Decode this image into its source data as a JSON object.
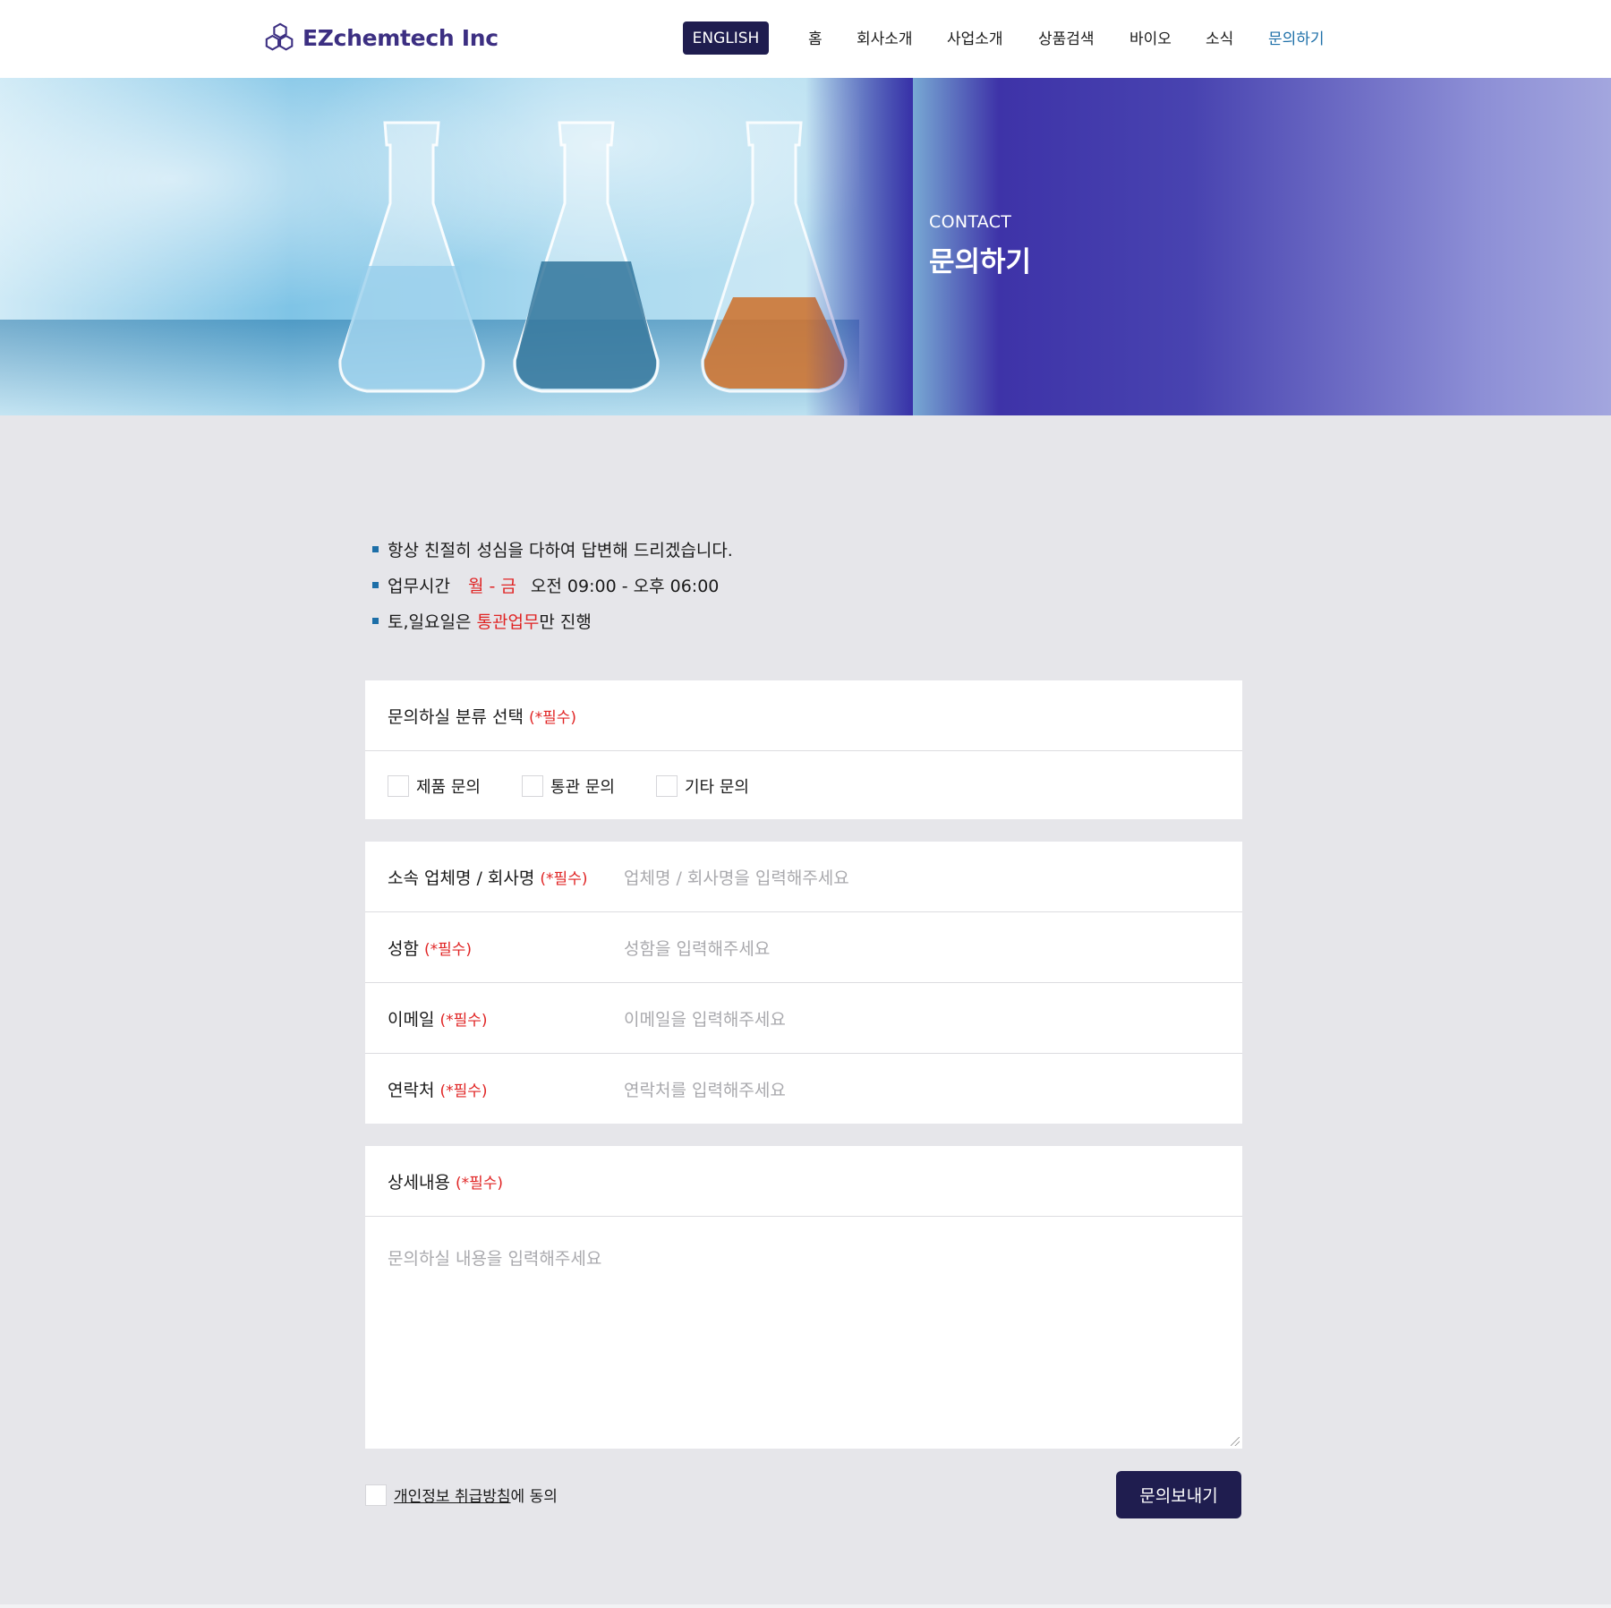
{
  "header": {
    "logo_text": "EZchemtech Inc",
    "lang_button": "ENGLISH",
    "nav": [
      {
        "label": "홈"
      },
      {
        "label": "회사소개"
      },
      {
        "label": "사업소개"
      },
      {
        "label": "상품검색"
      },
      {
        "label": "바이오"
      },
      {
        "label": "소식"
      },
      {
        "label": "문의하기",
        "active": true
      }
    ]
  },
  "hero": {
    "subtitle": "CONTACT",
    "title": "문의하기"
  },
  "info": {
    "line1": "항상 친절히 성심을 다하여 답변해 드리겠습니다.",
    "line2_prefix": "업무시간",
    "line2_days": "월 - 금",
    "line2_hours": "오전 09:00 - 오후 06:00",
    "line3_prefix": "토,일요일은 ",
    "line3_highlight": "통관업무",
    "line3_suffix": "만 진행"
  },
  "form": {
    "required_mark": "(*필수)",
    "category": {
      "label": "문의하실 분류 선택",
      "options": [
        "제품 문의",
        "통관 문의",
        "기타 문의"
      ]
    },
    "company": {
      "label": "소속 업체명 / 회사명",
      "placeholder": "업체명 / 회사명을 입력해주세요"
    },
    "name": {
      "label": "성함",
      "placeholder": "성함을 입력해주세요"
    },
    "email": {
      "label": "이메일",
      "placeholder": "이메일을 입력해주세요"
    },
    "phone": {
      "label": "연락처",
      "placeholder": "연락처를 입력해주세요"
    },
    "details": {
      "label": "상세내용",
      "placeholder": "문의하실 내용을 입력해주세요"
    },
    "agree_link": "개인정보 취급방침",
    "agree_suffix": "에 동의",
    "submit": "문의보내기"
  },
  "colors": {
    "brand": "#3c2f82",
    "button": "#1f1d4f",
    "required": "#e02424",
    "active_nav": "#1d6fa8"
  }
}
